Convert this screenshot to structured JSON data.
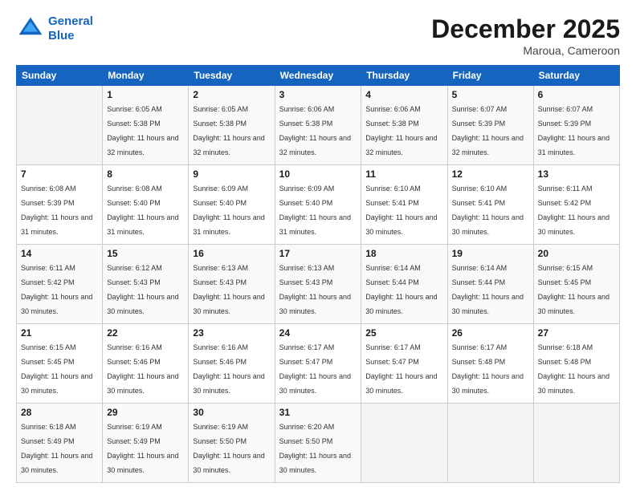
{
  "header": {
    "logo_line1": "General",
    "logo_line2": "Blue",
    "main_title": "December 2025",
    "subtitle": "Maroua, Cameroon"
  },
  "days_of_week": [
    "Sunday",
    "Monday",
    "Tuesday",
    "Wednesday",
    "Thursday",
    "Friday",
    "Saturday"
  ],
  "weeks": [
    [
      {
        "day": "",
        "info": ""
      },
      {
        "day": "1",
        "info": "Sunrise: 6:05 AM\nSunset: 5:38 PM\nDaylight: 11 hours\nand 32 minutes."
      },
      {
        "day": "2",
        "info": "Sunrise: 6:05 AM\nSunset: 5:38 PM\nDaylight: 11 hours\nand 32 minutes."
      },
      {
        "day": "3",
        "info": "Sunrise: 6:06 AM\nSunset: 5:38 PM\nDaylight: 11 hours\nand 32 minutes."
      },
      {
        "day": "4",
        "info": "Sunrise: 6:06 AM\nSunset: 5:38 PM\nDaylight: 11 hours\nand 32 minutes."
      },
      {
        "day": "5",
        "info": "Sunrise: 6:07 AM\nSunset: 5:39 PM\nDaylight: 11 hours\nand 32 minutes."
      },
      {
        "day": "6",
        "info": "Sunrise: 6:07 AM\nSunset: 5:39 PM\nDaylight: 11 hours\nand 31 minutes."
      }
    ],
    [
      {
        "day": "7",
        "info": "Sunrise: 6:08 AM\nSunset: 5:39 PM\nDaylight: 11 hours\nand 31 minutes."
      },
      {
        "day": "8",
        "info": "Sunrise: 6:08 AM\nSunset: 5:40 PM\nDaylight: 11 hours\nand 31 minutes."
      },
      {
        "day": "9",
        "info": "Sunrise: 6:09 AM\nSunset: 5:40 PM\nDaylight: 11 hours\nand 31 minutes."
      },
      {
        "day": "10",
        "info": "Sunrise: 6:09 AM\nSunset: 5:40 PM\nDaylight: 11 hours\nand 31 minutes."
      },
      {
        "day": "11",
        "info": "Sunrise: 6:10 AM\nSunset: 5:41 PM\nDaylight: 11 hours\nand 30 minutes."
      },
      {
        "day": "12",
        "info": "Sunrise: 6:10 AM\nSunset: 5:41 PM\nDaylight: 11 hours\nand 30 minutes."
      },
      {
        "day": "13",
        "info": "Sunrise: 6:11 AM\nSunset: 5:42 PM\nDaylight: 11 hours\nand 30 minutes."
      }
    ],
    [
      {
        "day": "14",
        "info": "Sunrise: 6:11 AM\nSunset: 5:42 PM\nDaylight: 11 hours\nand 30 minutes."
      },
      {
        "day": "15",
        "info": "Sunrise: 6:12 AM\nSunset: 5:43 PM\nDaylight: 11 hours\nand 30 minutes."
      },
      {
        "day": "16",
        "info": "Sunrise: 6:13 AM\nSunset: 5:43 PM\nDaylight: 11 hours\nand 30 minutes."
      },
      {
        "day": "17",
        "info": "Sunrise: 6:13 AM\nSunset: 5:43 PM\nDaylight: 11 hours\nand 30 minutes."
      },
      {
        "day": "18",
        "info": "Sunrise: 6:14 AM\nSunset: 5:44 PM\nDaylight: 11 hours\nand 30 minutes."
      },
      {
        "day": "19",
        "info": "Sunrise: 6:14 AM\nSunset: 5:44 PM\nDaylight: 11 hours\nand 30 minutes."
      },
      {
        "day": "20",
        "info": "Sunrise: 6:15 AM\nSunset: 5:45 PM\nDaylight: 11 hours\nand 30 minutes."
      }
    ],
    [
      {
        "day": "21",
        "info": "Sunrise: 6:15 AM\nSunset: 5:45 PM\nDaylight: 11 hours\nand 30 minutes."
      },
      {
        "day": "22",
        "info": "Sunrise: 6:16 AM\nSunset: 5:46 PM\nDaylight: 11 hours\nand 30 minutes."
      },
      {
        "day": "23",
        "info": "Sunrise: 6:16 AM\nSunset: 5:46 PM\nDaylight: 11 hours\nand 30 minutes."
      },
      {
        "day": "24",
        "info": "Sunrise: 6:17 AM\nSunset: 5:47 PM\nDaylight: 11 hours\nand 30 minutes."
      },
      {
        "day": "25",
        "info": "Sunrise: 6:17 AM\nSunset: 5:47 PM\nDaylight: 11 hours\nand 30 minutes."
      },
      {
        "day": "26",
        "info": "Sunrise: 6:17 AM\nSunset: 5:48 PM\nDaylight: 11 hours\nand 30 minutes."
      },
      {
        "day": "27",
        "info": "Sunrise: 6:18 AM\nSunset: 5:48 PM\nDaylight: 11 hours\nand 30 minutes."
      }
    ],
    [
      {
        "day": "28",
        "info": "Sunrise: 6:18 AM\nSunset: 5:49 PM\nDaylight: 11 hours\nand 30 minutes."
      },
      {
        "day": "29",
        "info": "Sunrise: 6:19 AM\nSunset: 5:49 PM\nDaylight: 11 hours\nand 30 minutes."
      },
      {
        "day": "30",
        "info": "Sunrise: 6:19 AM\nSunset: 5:50 PM\nDaylight: 11 hours\nand 30 minutes."
      },
      {
        "day": "31",
        "info": "Sunrise: 6:20 AM\nSunset: 5:50 PM\nDaylight: 11 hours\nand 30 minutes."
      },
      {
        "day": "",
        "info": ""
      },
      {
        "day": "",
        "info": ""
      },
      {
        "day": "",
        "info": ""
      }
    ]
  ]
}
